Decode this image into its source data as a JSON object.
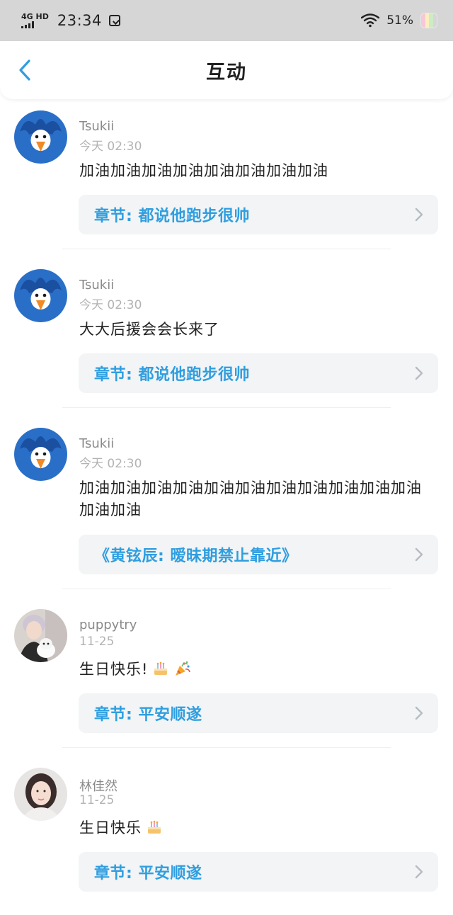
{
  "status_bar": {
    "network": "4G HD",
    "time": "23:34",
    "battery_percent": "51%",
    "signal_icon": "signal-bars-icon",
    "wifi_icon": "wifi-icon",
    "battery_icon": "battery-icon",
    "extra_icon": "notification-status-icon"
  },
  "header": {
    "title": "互动",
    "back_icon": "back-chevron-icon",
    "accent_color": "#2f9ee0"
  },
  "items": [
    {
      "username": "Tsukii",
      "time": "今天 02:30",
      "comment": "加油加油加油加油加油加油加油加油",
      "reference": "章节: 都说他跑步很帅",
      "avatar": "bird-avatar"
    },
    {
      "username": "Tsukii",
      "time": "今天 02:30",
      "comment": "大大后援会会长来了",
      "reference": "章节: 都说他跑步很帅",
      "avatar": "bird-avatar"
    },
    {
      "username": "Tsukii",
      "time": "今天 02:30",
      "comment": "加油加油加油加油加油加油加油加油加油加油加油加油加油",
      "reference": "《黄铉辰: 暧昧期禁止靠近》",
      "avatar": "bird-avatar"
    },
    {
      "username": "puppytry",
      "time": "11-25",
      "comment": "生日快乐!",
      "reference": "章节: 平安顺遂",
      "avatar": "person-with-dog-avatar",
      "emojis": [
        "cake-emoji",
        "party-popper-emoji"
      ]
    },
    {
      "username": "林佳然",
      "time": "11-25",
      "comment": "生日快乐",
      "reference": "章节: 平安顺遂",
      "avatar": "person-portrait-avatar",
      "emojis": [
        "cake-emoji"
      ]
    }
  ]
}
